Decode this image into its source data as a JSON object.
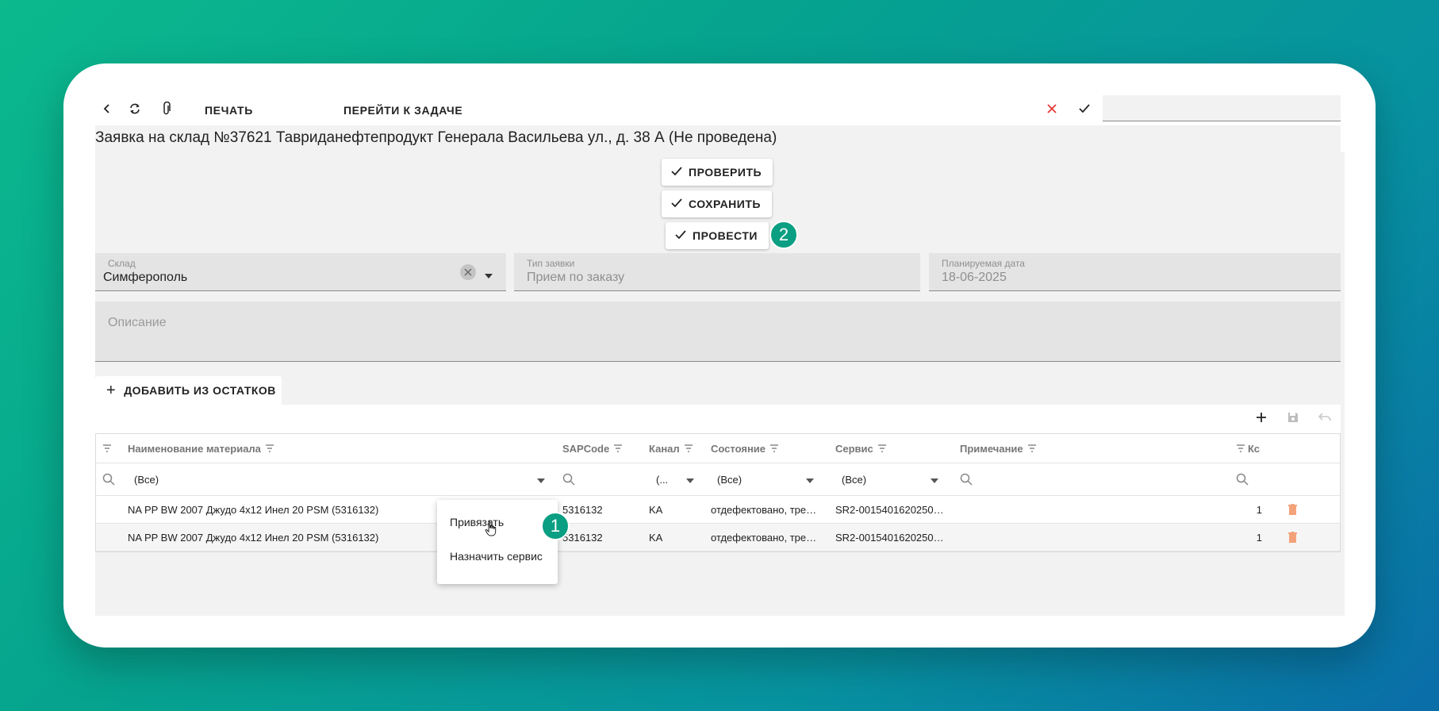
{
  "toolbar": {
    "print_label": "ПЕЧАТЬ",
    "goto_task_label": "ПЕРЕЙТИ К ЗАДАЧЕ",
    "search_value": ""
  },
  "title": "Заявка на склад №37621 Тавриданефтепродукт Генерала Васильева ул., д. 38 А (Не проведена)",
  "actions": {
    "check_label": "ПРОВЕРИТЬ",
    "save_label": "СОХРАНИТЬ",
    "post_label": "ПРОВЕСТИ"
  },
  "badges": {
    "post": "2",
    "context": "1"
  },
  "fields": {
    "warehouse": {
      "label": "Склад",
      "value": "Симферополь"
    },
    "request_type": {
      "label": "Тип заявки",
      "value": "Прием по заказу"
    },
    "planned_date": {
      "label": "Планируемая дата",
      "value": "18-06-2025"
    },
    "description": {
      "label": "Описание"
    }
  },
  "add_from_stock_label": "ДОБАВИТЬ ИЗ ОСТАТКОВ",
  "grid": {
    "columns": {
      "name": "Наименование материала",
      "sapcode": "SAPCode",
      "channel": "Канал",
      "state": "Состояние",
      "service": "Сервис",
      "note": "Примечание",
      "qty": "Кс"
    },
    "filters": {
      "name": "(Все)",
      "channel": "(...",
      "state": "(Все)",
      "service": "(Все)"
    },
    "rows": [
      {
        "name": "NA PP BW 2007 Джудо 4х12 Инел 20 PSM (5316132)",
        "sapcode": "5316132",
        "channel": "KA",
        "state": "отдефектовано, тре…",
        "service": "SR2-0015401620250…",
        "note": "",
        "qty": "1"
      },
      {
        "name": "NA PP BW 2007 Джудо 4х12 Инел 20 PSM (5316132)",
        "sapcode": "5316132",
        "channel": "KA",
        "state": "отдефектовано, тре…",
        "service": "SR2-0015401620250…",
        "note": "",
        "qty": "1"
      }
    ]
  },
  "context_menu": {
    "bind_label": "Привязать",
    "assign_service_label": "Назначить сервис"
  },
  "colors": {
    "accent_badge": "#0a9e82",
    "cancel_red": "#e53935",
    "delete_orange": "#f4a27a"
  }
}
